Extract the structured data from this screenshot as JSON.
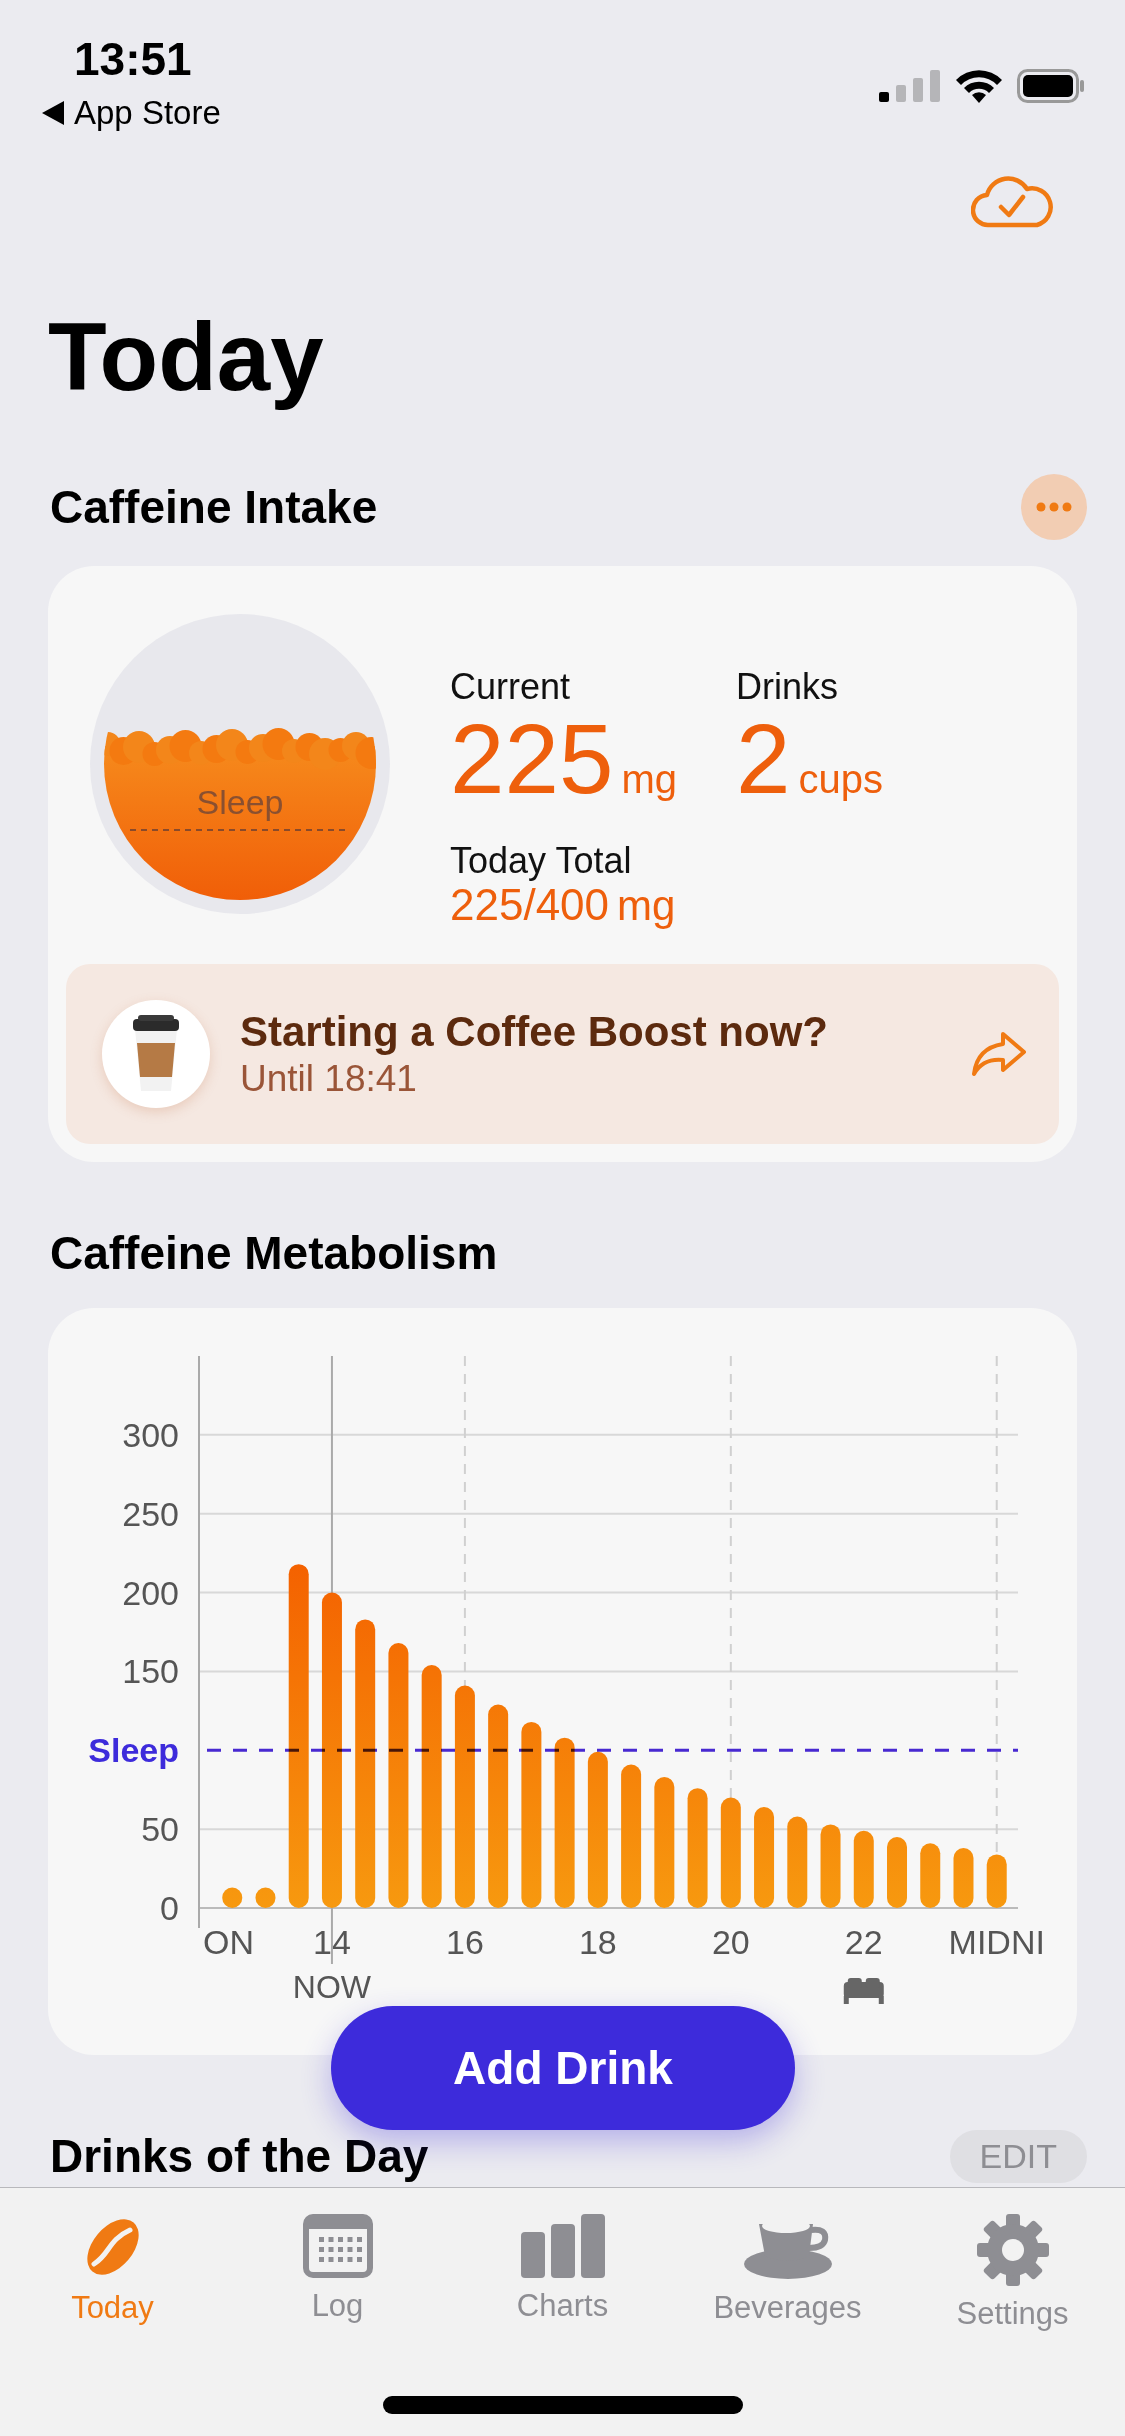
{
  "status_bar": {
    "time": "13:51",
    "back_label": "App Store"
  },
  "page_title": "Today",
  "intake": {
    "title": "Caffeine Intake",
    "gauge": {
      "label": "Sleep"
    },
    "current": {
      "label": "Current",
      "value": "225",
      "unit": "mg"
    },
    "drinks": {
      "label": "Drinks",
      "value": "2",
      "unit": "cups"
    },
    "total": {
      "label": "Today Total",
      "value": "225/400",
      "unit": "mg"
    },
    "boost": {
      "title": "Starting a Coffee Boost now?",
      "subtitle": "Until 18:41"
    }
  },
  "metabolism": {
    "title": "Caffeine Metabolism",
    "chart_data": {
      "type": "bar",
      "x": [
        12.5,
        13,
        13.5,
        14,
        14.5,
        15,
        15.5,
        16,
        16.5,
        17,
        17.5,
        18,
        18.5,
        19,
        19.5,
        20,
        20.5,
        21,
        21.5,
        22,
        22.5,
        23,
        23.5,
        24
      ],
      "values": [
        13,
        13,
        218,
        200,
        183,
        168,
        154,
        141,
        129,
        118,
        108,
        99,
        91,
        83,
        76,
        70,
        64,
        58,
        53,
        49,
        45,
        41,
        38,
        34
      ],
      "xlim": [
        12,
        24.32
      ],
      "ylim": [
        0,
        350
      ],
      "grid": true,
      "yticks": [
        0,
        50,
        150,
        200,
        250,
        300
      ],
      "xticks": [
        {
          "value": 12,
          "label": "ON"
        },
        {
          "value": 14,
          "label": "14"
        },
        {
          "value": 16,
          "label": "16"
        },
        {
          "value": 18,
          "label": "18"
        },
        {
          "value": 20,
          "label": "20"
        },
        {
          "value": 22,
          "label": "22"
        },
        {
          "value": 24,
          "label": "MIDNI"
        }
      ],
      "ref_lines": [
        {
          "axis": "y",
          "value": 100,
          "label": "Sleep"
        },
        {
          "axis": "x",
          "value": 14,
          "label": "NOW"
        }
      ]
    }
  },
  "add_button": "Add Drink",
  "drinks_section": {
    "title": "Drinks of the Day",
    "edit_label": "EDIT"
  },
  "tabs": [
    {
      "label": "Today",
      "selected": true
    },
    {
      "label": "Log",
      "selected": false
    },
    {
      "label": "Charts",
      "selected": false
    },
    {
      "label": "Beverages",
      "selected": false
    },
    {
      "label": "Settings",
      "selected": false
    }
  ]
}
